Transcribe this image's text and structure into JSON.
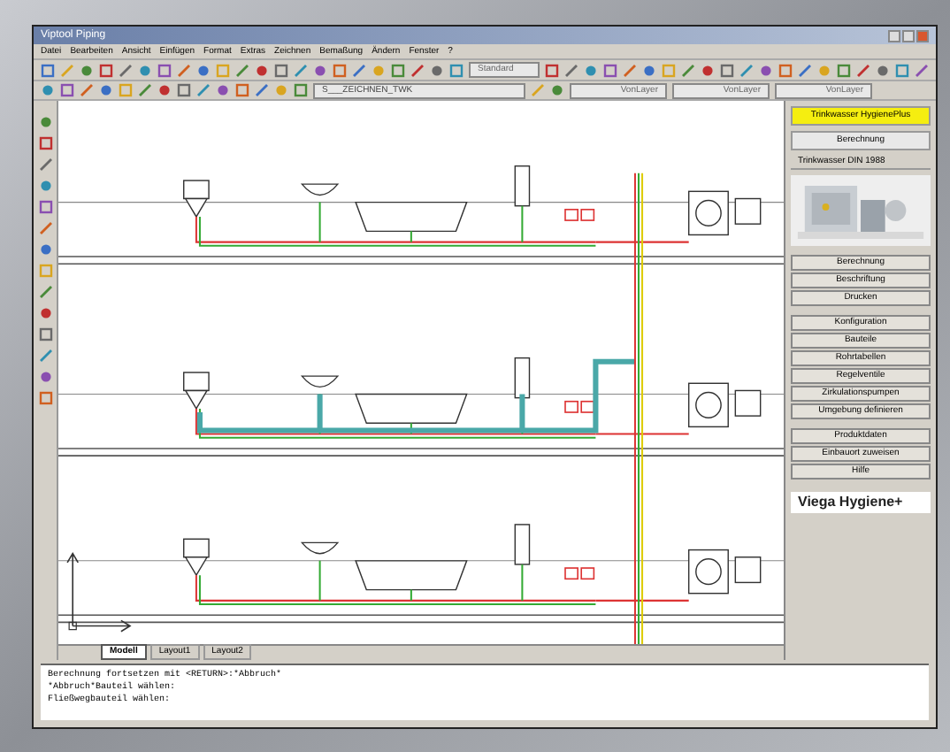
{
  "window": {
    "title": "Viptool Piping"
  },
  "menu": [
    "Datei",
    "Bearbeiten",
    "Ansicht",
    "Einfügen",
    "Format",
    "Extras",
    "Zeichnen",
    "Bemaßung",
    "Ändern",
    "Fenster",
    "?"
  ],
  "toolbar": {
    "style_combo": "Standard",
    "layer_combo": "S___ZEICHNEN_TWK",
    "property_combos": [
      "VonLayer",
      "VonLayer",
      "VonLayer"
    ]
  },
  "side_panel": {
    "dropdown": "Trinkwasser HygienePlus",
    "section": "Berechnung",
    "header": "Trinkwasser DIN 1988",
    "button_groups": [
      [
        "Berechnung",
        "Beschriftung",
        "Drucken"
      ],
      [
        "Konfiguration",
        "Bauteile",
        "Rohrtabellen",
        "Regelventile",
        "Zirkulationspumpen",
        "Umgebung definieren"
      ],
      [
        "Produktdaten",
        "Einbauort zuweisen",
        "Hilfe"
      ]
    ],
    "brand": "Viega Hygiene+"
  },
  "layout_tabs": [
    {
      "label": "Modell",
      "selected": true
    },
    {
      "label": "Layout1",
      "selected": false
    },
    {
      "label": "Layout2",
      "selected": false
    }
  ],
  "command_lines": [
    "Berechnung fortsetzen mit <RETURN>:*Abbruch*",
    "*Abbruch*Bauteil wählen:",
    "Fließwegbauteil wählen:"
  ]
}
